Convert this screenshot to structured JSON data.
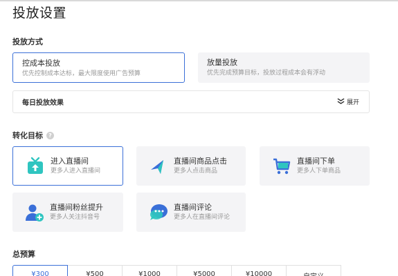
{
  "page": {
    "title": "投放设置"
  },
  "delivery_method": {
    "label": "投放方式",
    "options": [
      {
        "title": "控成本投放",
        "desc": "优先控制成本达标，最大限度使用广告预算",
        "selected": true
      },
      {
        "title": "放量投放",
        "desc": "优先完成预算目标，投放过程成本会有浮动",
        "selected": false
      }
    ]
  },
  "daily_effect": {
    "label": "每日投放效果",
    "expand_label": "展开"
  },
  "conversion_goal": {
    "label": "转化目标",
    "help": "?",
    "options": [
      {
        "title": "进入直播间",
        "desc": "更多人进入直播间",
        "icon": "enter-live-room-icon",
        "selected": true
      },
      {
        "title": "直播间商品点击",
        "desc": "更多人点击商品",
        "icon": "product-click-icon",
        "selected": false
      },
      {
        "title": "直播间下单",
        "desc": "更多人下单商品",
        "icon": "shopping-cart-icon",
        "selected": false
      },
      {
        "title": "直播间粉丝提升",
        "desc": "更多人关注抖音号",
        "icon": "add-follower-icon",
        "selected": false
      },
      {
        "title": "直播间评论",
        "desc": "更多人在直播间评论",
        "icon": "comment-icon",
        "selected": false
      }
    ]
  },
  "budget": {
    "label": "总预算",
    "options": [
      {
        "label": "¥300",
        "selected": true
      },
      {
        "label": "¥500",
        "selected": false
      },
      {
        "label": "¥1000",
        "selected": false
      },
      {
        "label": "¥5000",
        "selected": false
      },
      {
        "label": "¥10000",
        "selected": false
      },
      {
        "label": "自定义",
        "selected": false
      }
    ]
  },
  "colors": {
    "accent": "#3a6fd8",
    "card_bg": "#f4f4f6",
    "icon_teal": "#2fc5c0",
    "icon_blue": "#3a6fd8"
  }
}
